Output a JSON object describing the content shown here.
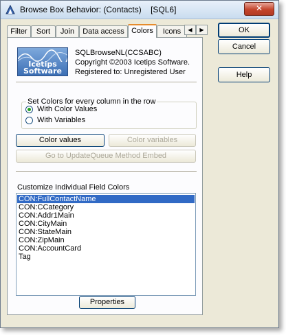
{
  "window": {
    "title": "Browse Box Behavior: (Contacts)    [SQL6]",
    "close_label": "✕"
  },
  "tabs": [
    {
      "label": "Filter"
    },
    {
      "label": "Sort"
    },
    {
      "label": "Join"
    },
    {
      "label": "Data access"
    },
    {
      "label": "Colors"
    },
    {
      "label": "Icons"
    }
  ],
  "tab_arrows": {
    "left": "◀",
    "right": "▶"
  },
  "logo": {
    "line1": "Icetips",
    "line2": "Software"
  },
  "info": {
    "product": "SQLBrowseNL(CCSABC)",
    "copyright": "Copyright ©2003 Icetips Software.",
    "registered": "Registered to: Unregistered User"
  },
  "color_group": {
    "legend": "Set Colors for every column in the row",
    "option1": "With Color Values",
    "option2": "With Variables"
  },
  "buttons": {
    "color_values": "Color values",
    "color_variables": "Color variables",
    "goto_embed": "Go to UpdateQueue Method Embed",
    "properties": "Properties",
    "ok": "OK",
    "cancel": "Cancel",
    "help": "Help"
  },
  "fields": {
    "label": "Customize Individual Field Colors",
    "items": [
      "CON:FullContactName",
      "CON:CCategory",
      "CON:Addr1Main",
      "CON:CityMain",
      "CON:StateMain",
      "CON:ZipMain",
      "CON:AccountCard",
      "Tag"
    ],
    "selected_index": 0
  }
}
